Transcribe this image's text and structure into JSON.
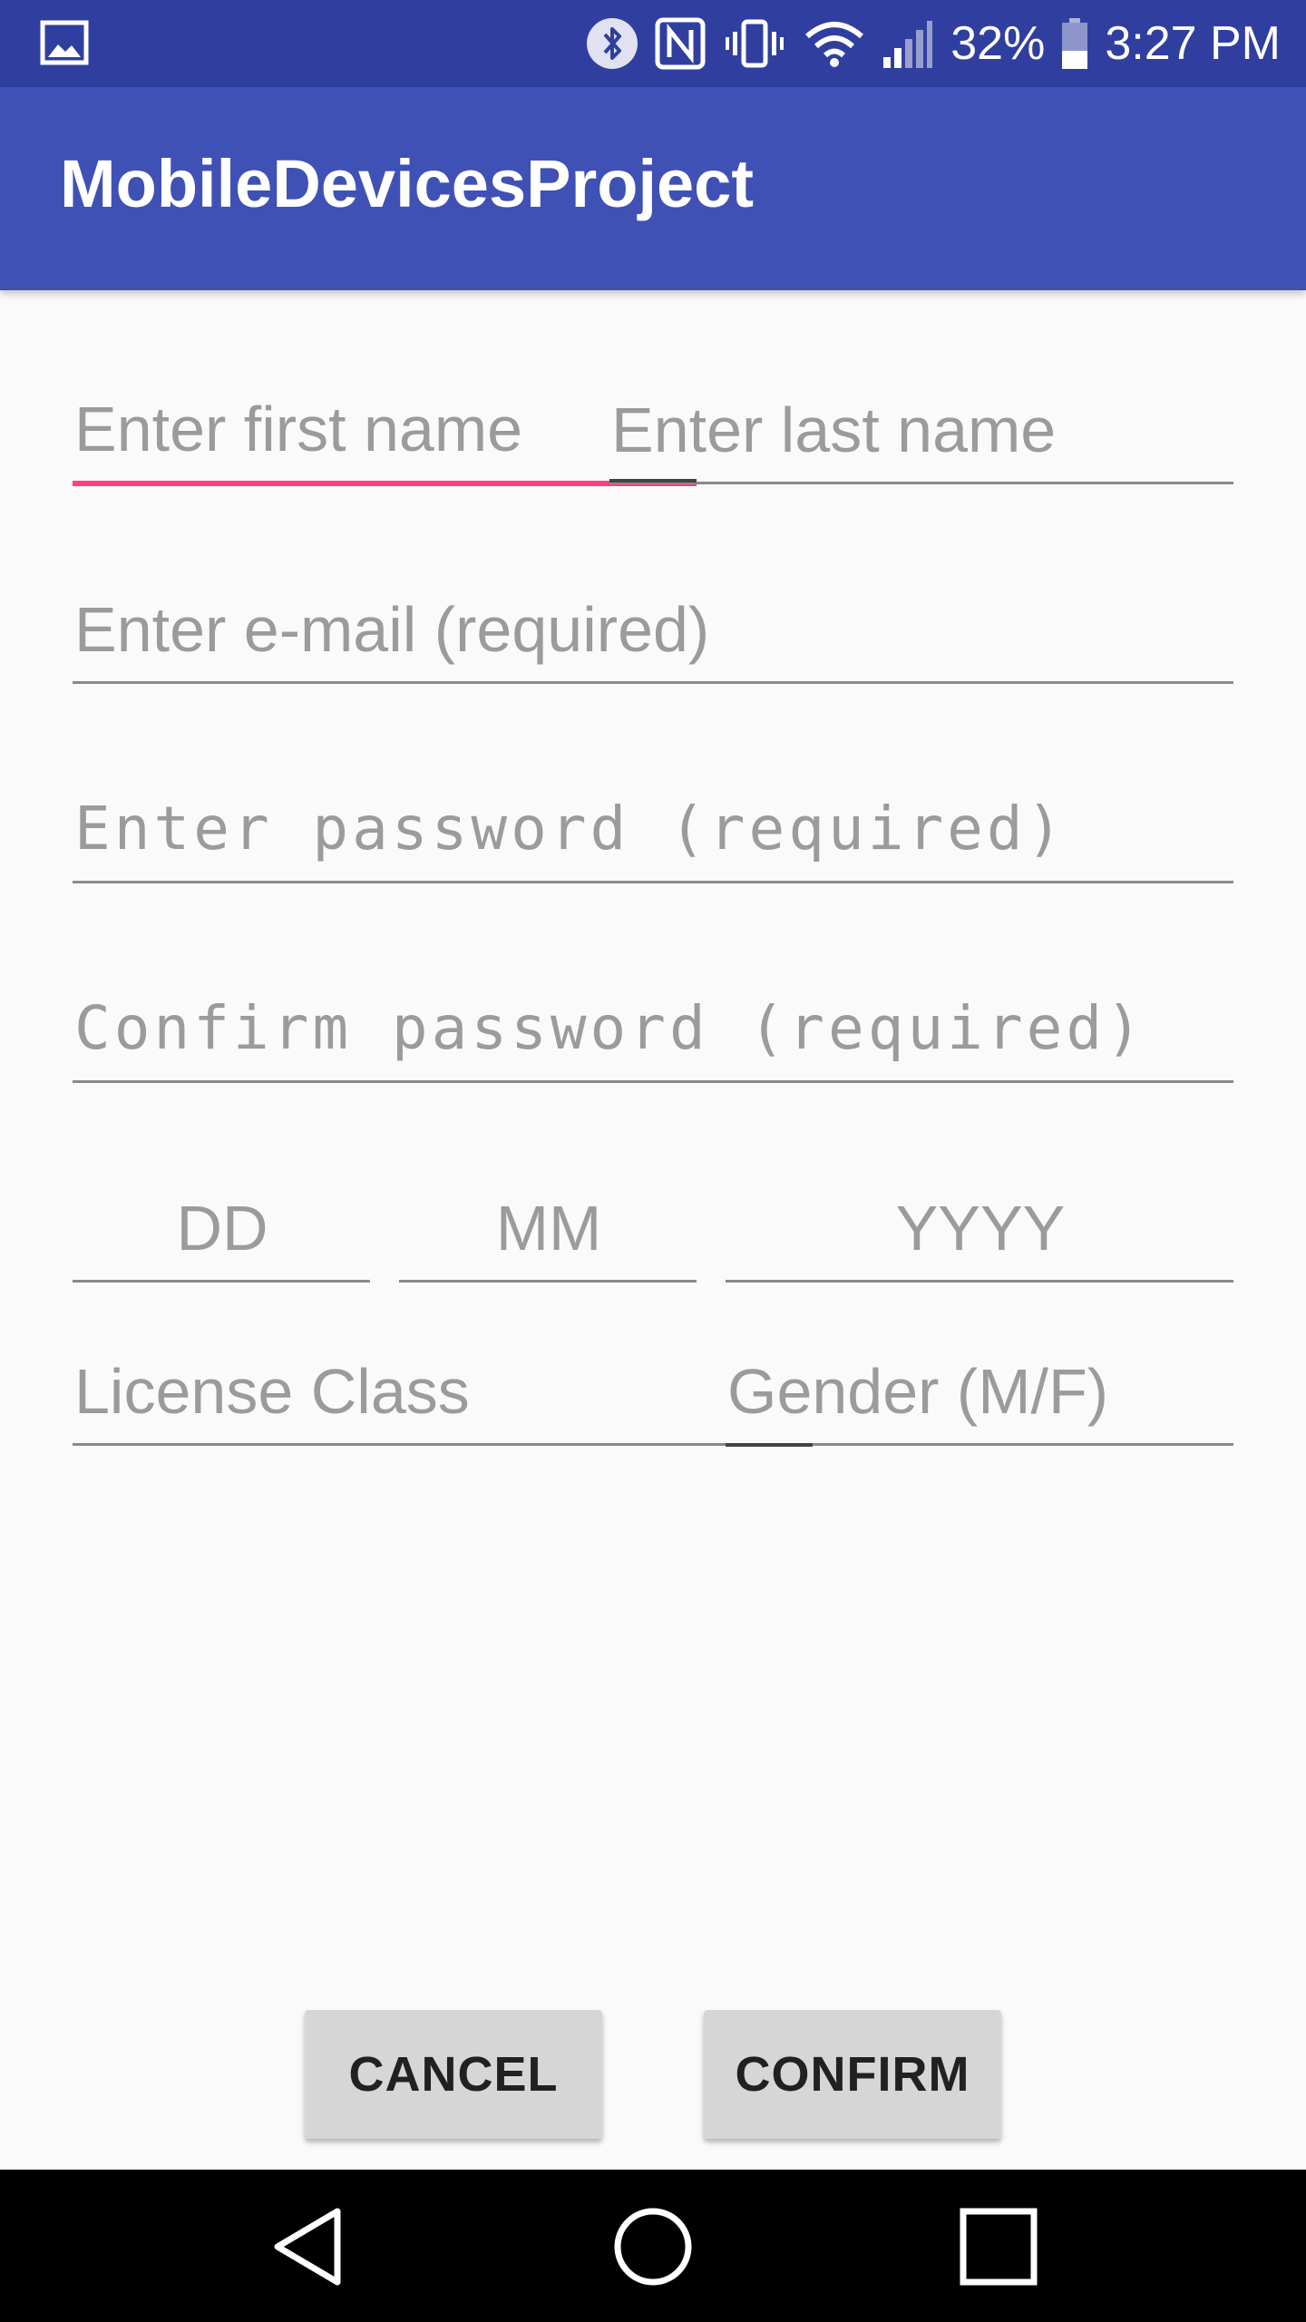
{
  "status_bar": {
    "battery_percent": "32%",
    "time": "3:27 PM",
    "icons": [
      "gallery-icon",
      "bluetooth-icon",
      "nfc-icon",
      "vibrate-icon",
      "wifi-icon",
      "signal-icon",
      "battery-icon"
    ]
  },
  "app_bar": {
    "title": "MobileDevicesProject"
  },
  "form": {
    "first_name": {
      "placeholder": "Enter first name",
      "value": ""
    },
    "last_name": {
      "placeholder": "Enter last name",
      "value": ""
    },
    "email": {
      "placeholder": "Enter e-mail (required)",
      "value": ""
    },
    "password": {
      "placeholder": "Enter password (required)",
      "value": ""
    },
    "confirm_password": {
      "placeholder": "Confirm password (required)",
      "value": ""
    },
    "day": {
      "placeholder": "DD",
      "value": ""
    },
    "month": {
      "placeholder": "MM",
      "value": ""
    },
    "year": {
      "placeholder": "YYYY",
      "value": ""
    },
    "license_class": {
      "placeholder": "License Class",
      "value": ""
    },
    "gender": {
      "placeholder": "Gender (M/F)",
      "value": ""
    }
  },
  "buttons": {
    "cancel": "CANCEL",
    "confirm": "CONFIRM"
  },
  "nav_bar": {
    "icons": [
      "back-icon",
      "home-icon",
      "recents-icon"
    ]
  },
  "colors": {
    "status_bar": "#303f9f",
    "app_bar": "#3f51b5",
    "accent": "#ff4081",
    "background": "#fafafa",
    "button": "#d6d6d6"
  }
}
